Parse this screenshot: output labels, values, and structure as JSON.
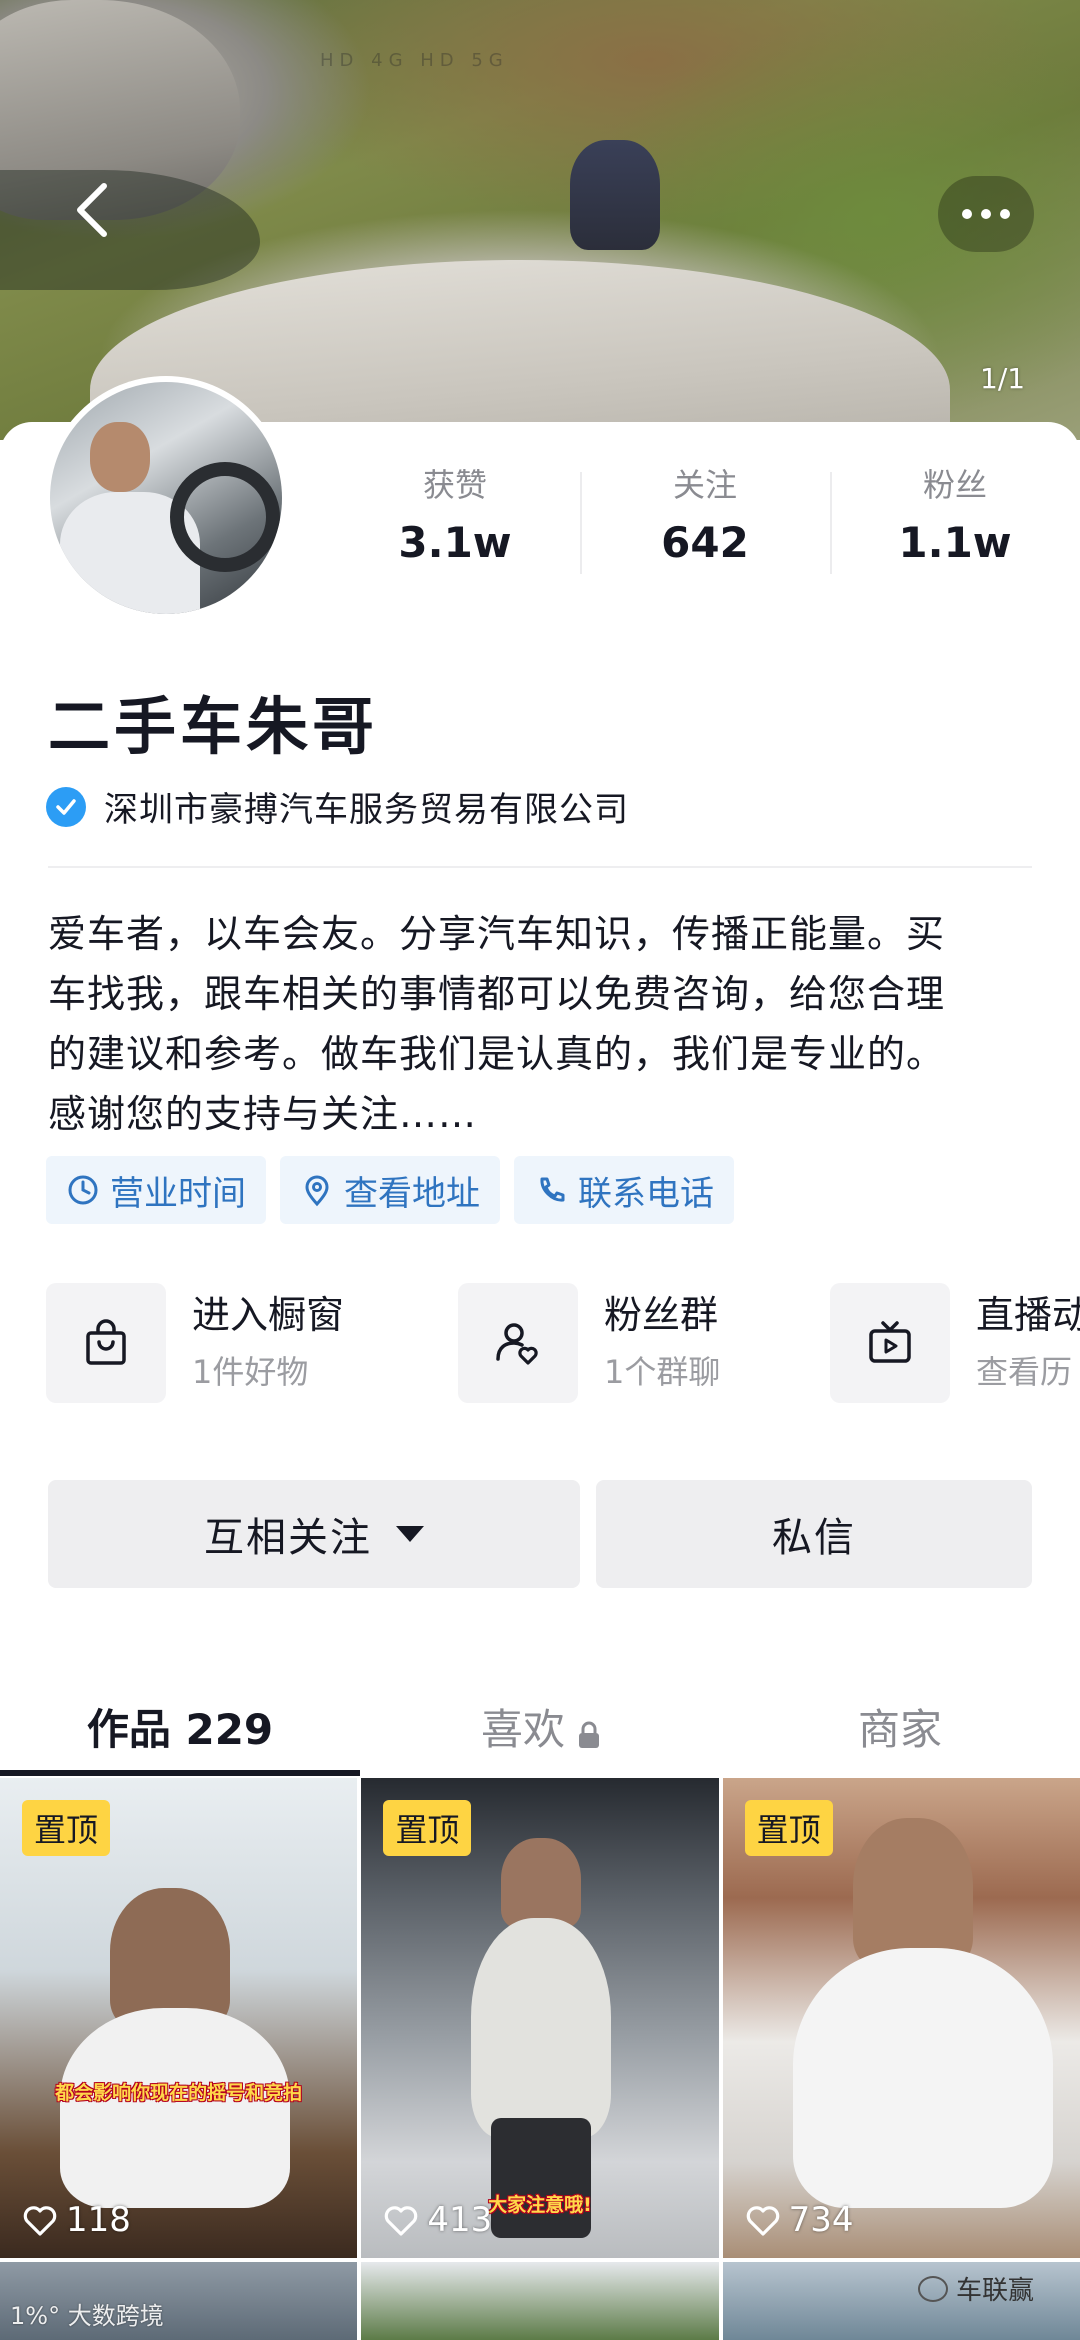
{
  "cover": {
    "pager": "1/1",
    "status_text": "HD 4G HD 5G"
  },
  "profile": {
    "stats": [
      {
        "label": "获赞",
        "value": "3.1w"
      },
      {
        "label": "关注",
        "value": "642"
      },
      {
        "label": "粉丝",
        "value": "1.1w"
      }
    ],
    "name": "二手车朱哥",
    "verified_company": "深圳市豪搏汽车服务贸易有限公司",
    "bio_lines": [
      "爱车者，以车会友。分享汽车知识，传播正能量。买",
      "车找我，跟车相关的事情都可以免费咨询，给您合理",
      "的建议和参考。做车我们是认真的，我们是专业的。",
      "感谢您的支持与关注……"
    ],
    "chips": [
      {
        "label": "营业时间",
        "icon": "clock-icon"
      },
      {
        "label": "查看地址",
        "icon": "location-pin-icon"
      },
      {
        "label": "联系电话",
        "icon": "phone-icon"
      }
    ],
    "features": [
      {
        "title": "进入橱窗",
        "sub": "1件好物",
        "icon": "shopping-bag-icon"
      },
      {
        "title": "粉丝群",
        "sub": "1个群聊",
        "icon": "fan-group-icon"
      },
      {
        "title": "直播动",
        "sub": "查看历",
        "icon": "tv-play-icon"
      }
    ],
    "buttons": {
      "follow": "互相关注",
      "message": "私信"
    }
  },
  "tabs": [
    {
      "label": "作品 229",
      "active": true
    },
    {
      "label": "喜欢",
      "locked": true
    },
    {
      "label": "商家"
    }
  ],
  "videos": [
    {
      "tag": "置顶",
      "likes": "118",
      "caption": "都会影响你现在的摇号和竞拍"
    },
    {
      "tag": "置顶",
      "likes": "413",
      "caption": "大家注意哦!"
    },
    {
      "tag": "置顶",
      "likes": "734"
    }
  ],
  "watermarks": {
    "left": "1%° 大数跨境",
    "right": "车联赢"
  },
  "colors": {
    "accent_blue": "#2f74c0",
    "verify_blue": "#2c9df5",
    "pin_tag_yellow": "#fed443",
    "text_primary": "#161823",
    "text_secondary": "#8a8b91"
  }
}
